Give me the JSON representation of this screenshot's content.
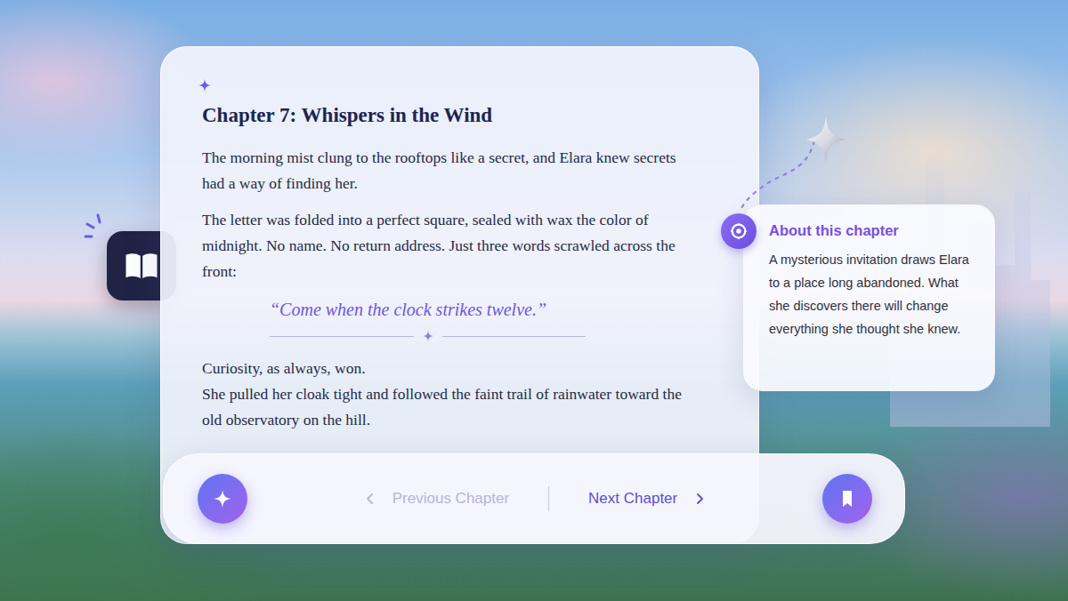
{
  "chapter": {
    "title": "Chapter 7: Whispers in the Wind",
    "paragraphs": [
      "The morning mist clung to the rooftops like a secret, and Elara knew secrets had a way of finding her.",
      "The letter was folded into a perfect square, sealed with wax the color of midnight. No name. No return address. Just three words scrawled across the front:"
    ],
    "quote": "“Come when the clock strikes twelve.”",
    "closing_lines": [
      "Curiosity, as always, won.",
      "She pulled her cloak tight and followed the faint trail of rainwater toward the old observatory on the hill."
    ]
  },
  "about": {
    "title": "About this chapter",
    "text": "A mysterious invitation draws Elara to a place long abandoned. What she discovers there will change everything she thought she knew."
  },
  "nav": {
    "previous": {
      "label": "Previous Chapter",
      "disabled": true
    },
    "next": {
      "label": "Next Chapter",
      "disabled": false
    }
  }
}
